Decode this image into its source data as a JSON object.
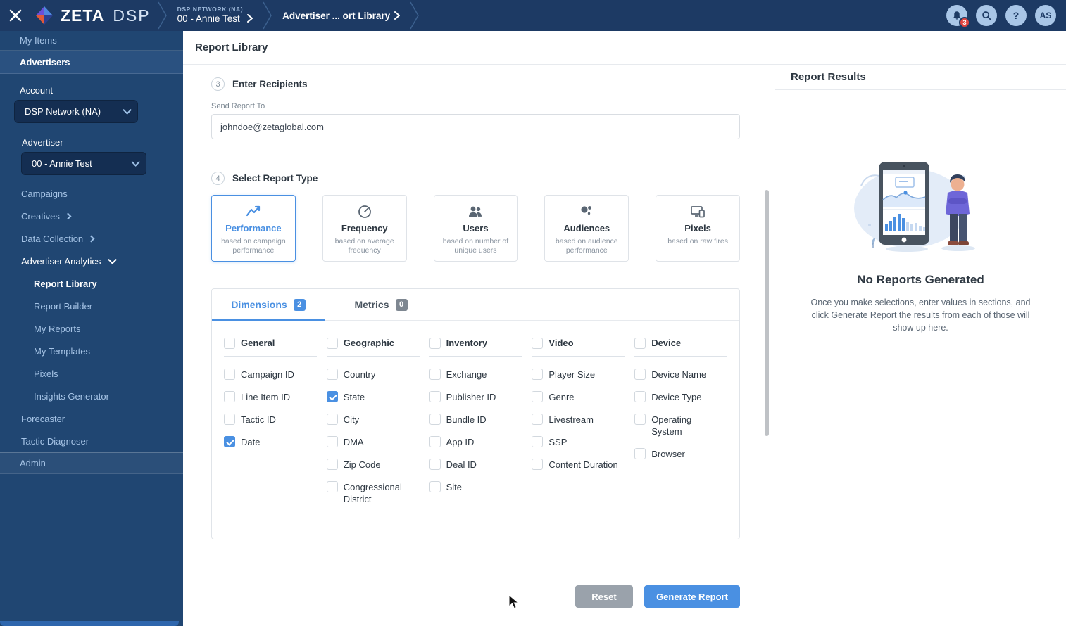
{
  "colors": {
    "accent": "#4a90e2",
    "navbar_navy": "#1d3a64",
    "sidebar_navy": "#204672",
    "sidebar_highlight": "#2a5180",
    "badge_red": "#e2453f",
    "reset_gray": "#9aa2ab",
    "checkbox_checked": "#4a90e2"
  },
  "navbar": {
    "close_icon": "close-icon",
    "brand": "ZETA",
    "product": "DSP",
    "logo_icon": "zeta-diamond-icon",
    "breadcrumb": [
      {
        "eyebrow": "DSP NETWORK (NA)",
        "label": "00 - Annie Test"
      },
      {
        "label": "Advertiser ... ort Library"
      }
    ],
    "notifications": {
      "icon": "bell-icon",
      "count": "3"
    },
    "search_icon": "search-icon",
    "help_label": "?",
    "avatar_initials": "AS"
  },
  "sidebar": {
    "my_items": "My Items",
    "advertisers": "Advertisers",
    "account": {
      "label": "Account",
      "value": "DSP Network (NA)"
    },
    "advertiser": {
      "label": "Advertiser",
      "value": "00 - Annie Test"
    },
    "links": [
      {
        "label": "Campaigns"
      },
      {
        "label": "Creatives"
      },
      {
        "label": "Data Collection"
      }
    ],
    "analytics": {
      "label": "Advertiser Analytics",
      "items": [
        {
          "label": "Report Library",
          "active": true
        },
        {
          "label": "Report Builder",
          "active": false
        },
        {
          "label": "My Reports",
          "active": false
        },
        {
          "label": "My Templates",
          "active": false
        },
        {
          "label": "Pixels",
          "active": false
        },
        {
          "label": "Insights Generator",
          "active": false
        }
      ]
    },
    "forecaster": "Forecaster",
    "tactic_diagnoser": "Tactic Diagnoser",
    "admin": "Admin"
  },
  "main": {
    "title": "Report Library",
    "recipients": {
      "step": "3",
      "heading": "Enter Recipients",
      "field_label": "Send Report To",
      "email": "johndoe@zetaglobal.com"
    },
    "report_type": {
      "step": "4",
      "heading": "Select Report Type",
      "cards": [
        {
          "name": "Performance",
          "desc": "based on campaign performance",
          "icon": "line-chart-icon",
          "selected": true
        },
        {
          "name": "Frequency",
          "desc": "based on average frequency",
          "icon": "gauge-icon",
          "selected": false
        },
        {
          "name": "Users",
          "desc": "based on number of unique users",
          "icon": "users-icon",
          "selected": false
        },
        {
          "name": "Audiences",
          "desc": "based on audience performance",
          "icon": "audience-dots-icon",
          "selected": false
        },
        {
          "name": "Pixels",
          "desc": "based on raw fires",
          "icon": "devices-icon",
          "selected": false
        }
      ]
    },
    "tabs": [
      {
        "label": "Dimensions",
        "count": "2",
        "active": true
      },
      {
        "label": "Metrics",
        "count": "0",
        "active": false
      }
    ],
    "dimension_groups": [
      {
        "name": "General",
        "checked": false,
        "items": [
          {
            "label": "Campaign ID",
            "checked": false
          },
          {
            "label": "Line Item ID",
            "checked": false
          },
          {
            "label": "Tactic ID",
            "checked": false
          },
          {
            "label": "Date",
            "checked": true
          }
        ]
      },
      {
        "name": "Geographic",
        "checked": false,
        "items": [
          {
            "label": "Country",
            "checked": false
          },
          {
            "label": "State",
            "checked": true
          },
          {
            "label": "City",
            "checked": false
          },
          {
            "label": "DMA",
            "checked": false
          },
          {
            "label": "Zip Code",
            "checked": false
          },
          {
            "label": "Congressional District",
            "checked": false
          }
        ]
      },
      {
        "name": "Inventory",
        "checked": false,
        "items": [
          {
            "label": "Exchange",
            "checked": false
          },
          {
            "label": "Publisher ID",
            "checked": false
          },
          {
            "label": "Bundle ID",
            "checked": false
          },
          {
            "label": "App ID",
            "checked": false
          },
          {
            "label": "Deal ID",
            "checked": false
          },
          {
            "label": "Site",
            "checked": false
          }
        ]
      },
      {
        "name": "Video",
        "checked": false,
        "items": [
          {
            "label": "Player Size",
            "checked": false
          },
          {
            "label": "Genre",
            "checked": false
          },
          {
            "label": "Livestream",
            "checked": false
          },
          {
            "label": "SSP",
            "checked": false
          },
          {
            "label": "Content Duration",
            "checked": false
          }
        ]
      },
      {
        "name": "Device",
        "checked": false,
        "items": [
          {
            "label": "Device Name",
            "checked": false
          },
          {
            "label": "Device Type",
            "checked": false
          },
          {
            "label": "Operating System",
            "checked": false
          },
          {
            "label": "Browser",
            "checked": false
          }
        ]
      }
    ],
    "buttons": {
      "reset": "Reset",
      "generate": "Generate Report"
    }
  },
  "results_panel": {
    "title": "Report Results",
    "illustration": "tablet-report-illustration",
    "empty_title": "No Reports Generated",
    "empty_message": "Once you make selections, enter values in sections, and click Generate Report the results from each of those will show up here."
  }
}
